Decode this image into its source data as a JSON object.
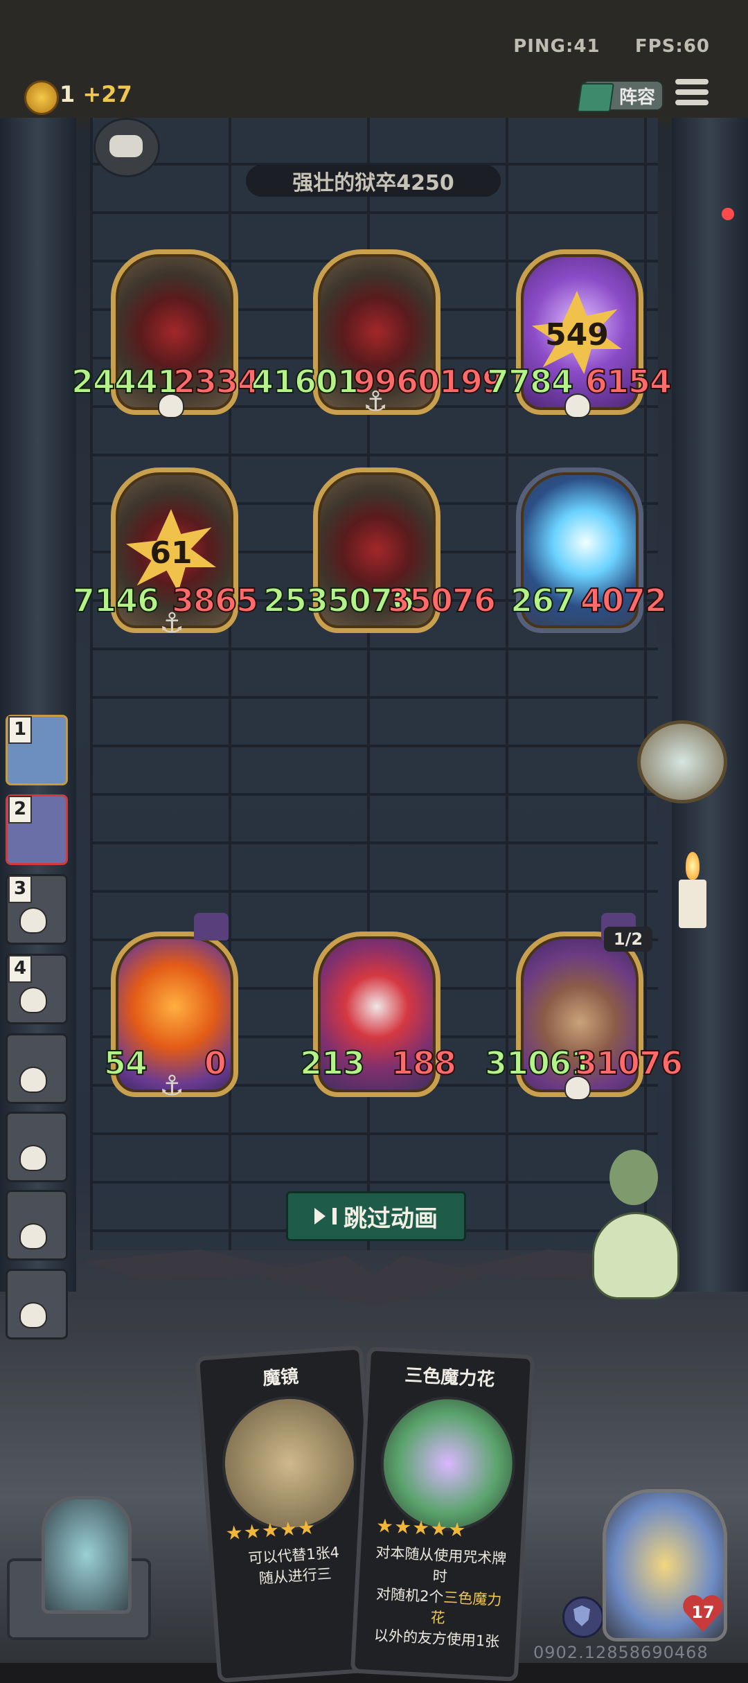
{
  "status": {
    "ping": "PING:41",
    "fps": "FPS:60"
  },
  "gold": {
    "amount": "1",
    "income": "+27"
  },
  "lineup_label": "阵容",
  "opponent": {
    "name": "强壮的狱卒4250"
  },
  "enemy_board": [
    {
      "kind": "jailer",
      "attack": "24441",
      "health": "2334",
      "marker": "skull-icon"
    },
    {
      "kind": "jailer",
      "attack": "41601",
      "health": "9960199",
      "marker": "anchor-icon"
    },
    {
      "kind": "purple",
      "star": "549",
      "attack": "7784",
      "health": "6154",
      "marker": "skull-icon"
    },
    {
      "kind": "jailer",
      "star": "61",
      "attack": "7146",
      "health": "3865",
      "marker": "anchor-icon"
    },
    {
      "kind": "jailer",
      "attack": "2535076",
      "health": "35076",
      "marker": "none"
    },
    {
      "kind": "blue",
      "attack": "267",
      "health": "4072",
      "marker": "none"
    }
  ],
  "player_board": [
    {
      "kind": "sun",
      "attack": "54",
      "health": "0",
      "marker": "anchor-icon"
    },
    {
      "kind": "clown",
      "attack": "213",
      "health": "188",
      "marker": "none"
    },
    {
      "kind": "castle",
      "attack": "31061",
      "health": "31076",
      "marker": "skull-icon",
      "badge": "1/2"
    }
  ],
  "sidebar": {
    "players": [
      {
        "rank": "1",
        "state": "gold"
      },
      {
        "rank": "2",
        "state": "red"
      },
      {
        "rank": "3",
        "state": "dead"
      },
      {
        "rank": "4",
        "state": "dead"
      },
      {
        "rank": "",
        "state": "dead"
      },
      {
        "rank": "",
        "state": "dead"
      },
      {
        "rank": "",
        "state": "dead"
      },
      {
        "rank": "",
        "state": "dead"
      }
    ]
  },
  "skip_button": "跳过动画",
  "hand": [
    {
      "title": "魔镜",
      "stars": "★★★★★",
      "desc1": "可以代替1张4",
      "desc2": "随从进行三"
    },
    {
      "title": "三色魔力花",
      "stars": "★★★★★",
      "desc1": "对本随从使用咒术牌时",
      "desc2a": "对随机2个",
      "desc2hl": "三色魔力花",
      "desc3": "以外的友方使用1张"
    }
  ],
  "player_health": "17",
  "footer_id": "0902.12858690468",
  "colors": {
    "attack": "#b6f28a",
    "health": "#ff6a6a",
    "skip_bg": "#1f5b49",
    "gold": "#f0c64e"
  }
}
